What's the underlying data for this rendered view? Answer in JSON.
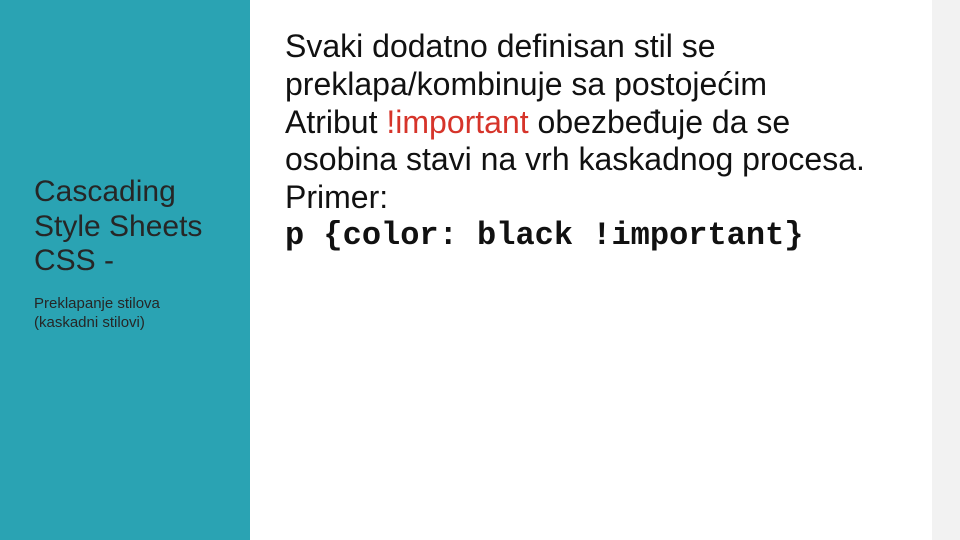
{
  "sidebar": {
    "title_line1": "Cascading",
    "title_line2": "Style Sheets",
    "title_line3": "CSS -",
    "subtitle_line1": "Preklapanje stilova",
    "subtitle_line2": "(kaskadni stilovi)"
  },
  "content": {
    "para1_a": "Svaki dodatno definisan stil se preklapa/kombinuje sa postojećim",
    "para2_a": "Atribut ",
    "para2_important": "!important",
    "para2_b": " obezbeđuje da se osobina stavi na vrh kaskadnog procesa.",
    "primer_label": "Primer:",
    "code": "p {color: black !important}"
  },
  "colors": {
    "sidebar_bg": "#2aa3b3",
    "important_text": "#d6342a"
  }
}
